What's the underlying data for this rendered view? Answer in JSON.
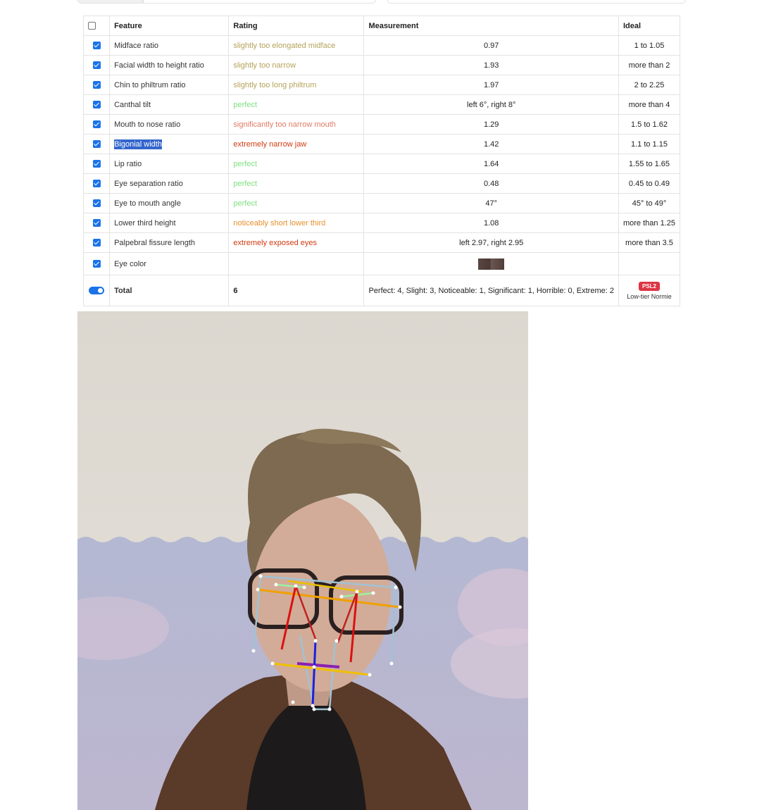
{
  "table": {
    "headers": {
      "feature": "Feature",
      "rating": "Rating",
      "measurement": "Measurement",
      "ideal": "Ideal"
    },
    "rows": [
      {
        "feature": "Midface ratio",
        "rating": "slightly too elongated midface",
        "rating_class": "slight",
        "measurement": "0.97",
        "ideal": "1 to 1.05"
      },
      {
        "feature": "Facial width to height ratio",
        "rating": "slightly too narrow",
        "rating_class": "slight",
        "measurement": "1.93",
        "ideal": "more than 2"
      },
      {
        "feature": "Chin to philtrum ratio",
        "rating": "slightly too long philtrum",
        "rating_class": "slight",
        "measurement": "1.97",
        "ideal": "2 to 2.25"
      },
      {
        "feature": "Canthal tilt",
        "rating": "perfect",
        "rating_class": "perfect",
        "measurement": "left 6°, right 8°",
        "ideal": "more than 4"
      },
      {
        "feature": "Mouth to nose ratio",
        "rating": "significantly too narrow mouth",
        "rating_class": "significant",
        "measurement": "1.29",
        "ideal": "1.5 to 1.62"
      },
      {
        "feature": "Bigonial width",
        "rating": "extremely narrow jaw",
        "rating_class": "extreme",
        "measurement": "1.42",
        "ideal": "1.1 to 1.15",
        "selected": true
      },
      {
        "feature": "Lip ratio",
        "rating": "perfect",
        "rating_class": "perfect",
        "measurement": "1.64",
        "ideal": "1.55 to 1.65"
      },
      {
        "feature": "Eye separation ratio",
        "rating": "perfect",
        "rating_class": "perfect",
        "measurement": "0.48",
        "ideal": "0.45 to 0.49"
      },
      {
        "feature": "Eye to mouth angle",
        "rating": "perfect",
        "rating_class": "perfect",
        "measurement": "47°",
        "ideal": "45° to 49°"
      },
      {
        "feature": "Lower third height",
        "rating": "noticeably short lower third",
        "rating_class": "noticeable",
        "measurement": "1.08",
        "ideal": "more than 1.25"
      },
      {
        "feature": "Palpebral fissure length",
        "rating": "extremely exposed eyes",
        "rating_class": "extreme",
        "measurement": "left 2.97, right 2.95",
        "ideal": "more than 3.5"
      },
      {
        "feature": "Eye color",
        "rating": "",
        "rating_class": "",
        "measurement": "",
        "ideal": "",
        "swatch": true
      }
    ],
    "total": {
      "label": "Total",
      "score": "6",
      "summary": "Perfect: 4, Slight: 3, Noticeable: 1, Significant: 1, Horrible: 0, Extreme: 2",
      "badge": "PSL2",
      "tier": "Low-tier Normie"
    }
  },
  "colors": {
    "slight": "#b5a25a",
    "perfect": "#7ddf7d",
    "significant": "#e07b63",
    "noticeable": "#e58f2a",
    "extreme": "#d03a10",
    "badge": "#dc3545",
    "checkbox": "#1a73e8"
  },
  "photo": {
    "subject": "face-photo"
  }
}
